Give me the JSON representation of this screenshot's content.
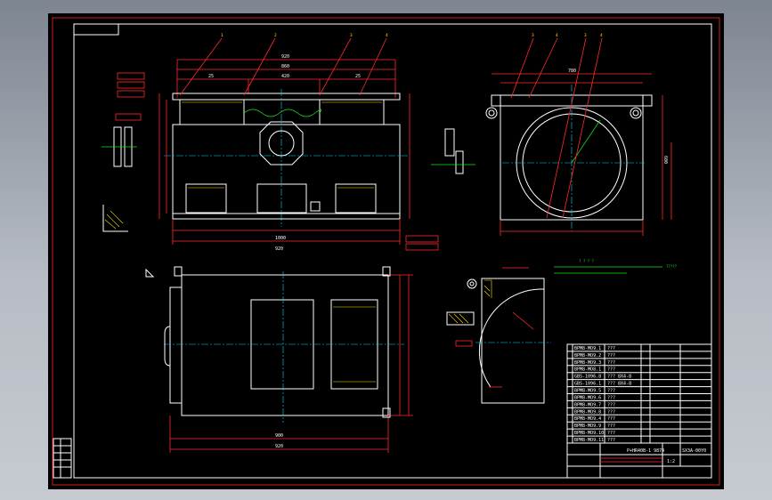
{
  "drawing": {
    "title_block": {
      "drawing_number": "SX3A-00Y0",
      "material_note": "P+HR40B-1 9874",
      "scale": "1:2"
    },
    "balloons_top_front": [
      "1",
      "2",
      "3",
      "4"
    ],
    "balloons_top_side": [
      "3",
      "4",
      "3",
      "4"
    ],
    "notes": [
      "? ? ? ?",
      "?????"
    ],
    "bom_rows": [
      {
        "code": "BPM8-MO9.1",
        "desc": "???"
      },
      {
        "code": "BPM8-MO9.2",
        "desc": "???"
      },
      {
        "code": "BPM8-MO9.3",
        "desc": "???"
      },
      {
        "code": "BPM8-MO8.1",
        "desc": "???"
      },
      {
        "code": "GBS-1096.8",
        "desc": "??? 8X4-8"
      },
      {
        "code": "GBS-1096.1",
        "desc": "??? 8X4-8"
      },
      {
        "code": "BPM8-MO9.5",
        "desc": "???"
      },
      {
        "code": "BPM8-MO9.6",
        "desc": "???"
      },
      {
        "code": "BPM8-MO9.7",
        "desc": "???"
      },
      {
        "code": "BPM8-MO9.8",
        "desc": "???"
      },
      {
        "code": "BPM8-MO9.4",
        "desc": "???"
      },
      {
        "code": "BPM8-MO9.9",
        "desc": "???"
      },
      {
        "code": "BPM8-MO9.10",
        "desc": "???"
      },
      {
        "code": "BPM8-MO9.11",
        "desc": "???"
      }
    ],
    "colors": {
      "background": "#000000",
      "outline": "#ffffff",
      "frame": "#ff2a2a",
      "dimension": "#19e619",
      "centerline": "#00d8ff",
      "hatch": "#ffe600"
    }
  }
}
